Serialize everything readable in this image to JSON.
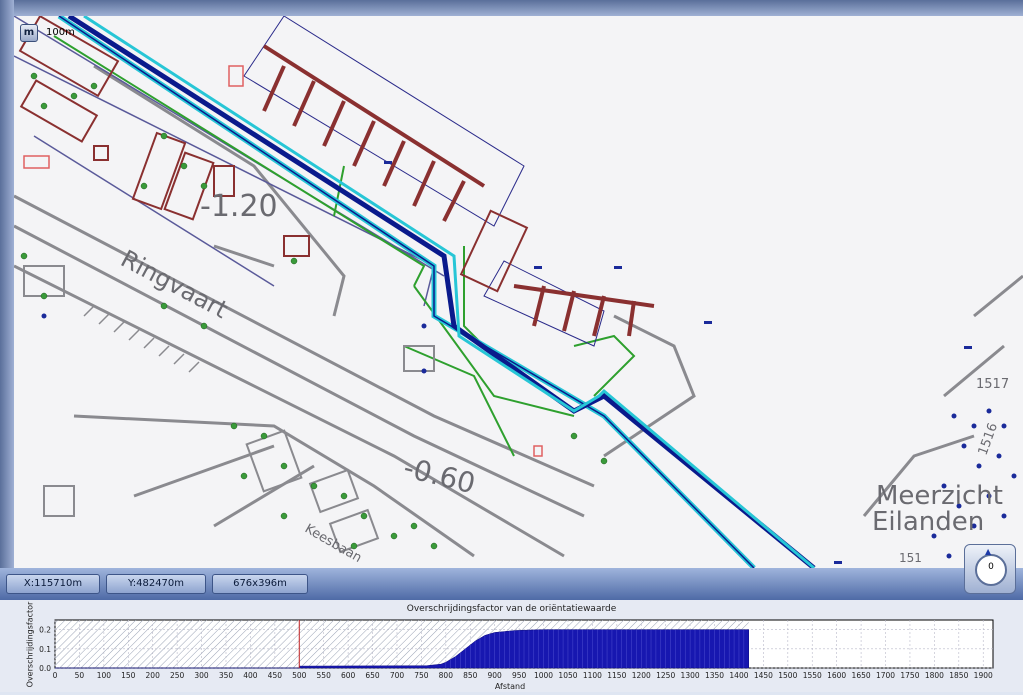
{
  "map": {
    "scale_label": "100m",
    "zoom_button": "m",
    "labels": {
      "level_1": "-1.20",
      "level_2": "-0.60",
      "waterway": "Ringvaart",
      "street": "Keesbaan",
      "area_line1": "Meerzicht",
      "area_line2": "Eilanden",
      "number_1517": "1517",
      "number_1516": "1516",
      "number_151": "151"
    }
  },
  "status": {
    "x": "X:115710m",
    "y": "Y:482470m",
    "size": "676x396m"
  },
  "compass": {
    "value": "0"
  },
  "colors": {
    "route_dark": "#0a1a8c",
    "route_light": "#27c6d6",
    "bars": "#1717b0"
  },
  "chart_data": {
    "type": "bar",
    "title": "Overschrijdingsfactor van de oriëntatiewaarde",
    "xlabel": "Afstand",
    "ylabel": "Overschrijdingsfactor",
    "xlim": [
      0,
      1920
    ],
    "ylim": [
      0,
      0.25
    ],
    "xticks": [
      0,
      50,
      100,
      150,
      200,
      250,
      300,
      350,
      400,
      450,
      500,
      550,
      600,
      650,
      700,
      750,
      800,
      850,
      900,
      950,
      1000,
      1050,
      1100,
      1150,
      1200,
      1250,
      1300,
      1350,
      1400,
      1450,
      1500,
      1550,
      1600,
      1650,
      1700,
      1750,
      1800,
      1850,
      1900
    ],
    "yticks": [
      0.0,
      0.1,
      0.2
    ],
    "marker_x": 500,
    "profile": [
      {
        "x": 0,
        "y": 0.0
      },
      {
        "x": 500,
        "y": 0.0
      },
      {
        "x": 500,
        "y": 0.01
      },
      {
        "x": 760,
        "y": 0.012
      },
      {
        "x": 790,
        "y": 0.02
      },
      {
        "x": 800,
        "y": 0.03
      },
      {
        "x": 820,
        "y": 0.06
      },
      {
        "x": 840,
        "y": 0.1
      },
      {
        "x": 860,
        "y": 0.14
      },
      {
        "x": 880,
        "y": 0.17
      },
      {
        "x": 900,
        "y": 0.185
      },
      {
        "x": 940,
        "y": 0.195
      },
      {
        "x": 1000,
        "y": 0.2
      },
      {
        "x": 1420,
        "y": 0.2
      },
      {
        "x": 1420,
        "y": 0.0
      }
    ]
  }
}
